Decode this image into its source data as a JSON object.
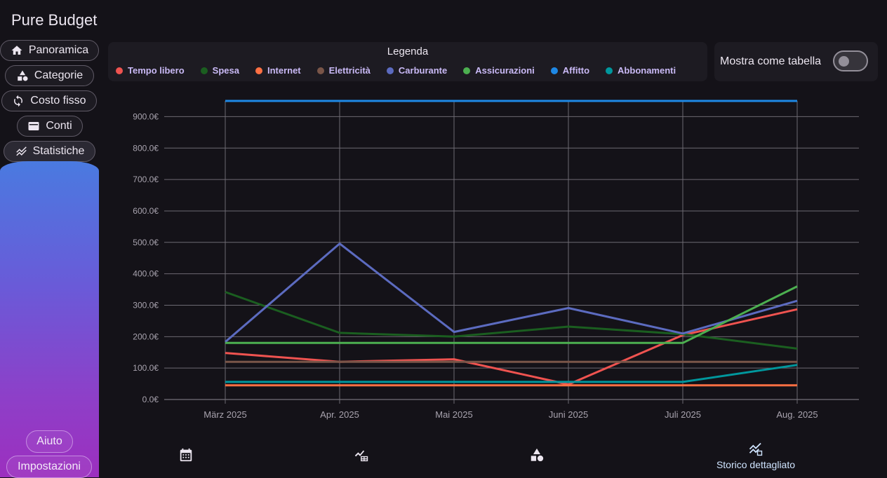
{
  "app": {
    "title": "Pure Budget"
  },
  "nav": {
    "items": [
      {
        "label": "Panoramica",
        "icon": "home-icon"
      },
      {
        "label": "Categorie",
        "icon": "shapes-icon"
      },
      {
        "label": "Costo fisso",
        "icon": "sync-icon"
      },
      {
        "label": "Conti",
        "icon": "wallet-icon"
      },
      {
        "label": "Statistiche",
        "icon": "trending-icon",
        "active": true
      }
    ],
    "bottom": [
      {
        "label": "Aiuto"
      },
      {
        "label": "Impostazioni"
      }
    ]
  },
  "legend": {
    "title": "Legenda"
  },
  "toggle": {
    "label": "Mostra come tabella",
    "on": false
  },
  "bottom_nav": {
    "items": [
      {
        "icon": "calendar-icon",
        "label": ""
      },
      {
        "icon": "chart-table-icon",
        "label": ""
      },
      {
        "icon": "shapes-icon",
        "label": ""
      },
      {
        "icon": "detailed-history-icon",
        "label": "Storico dettagliato",
        "active": true
      }
    ]
  },
  "chart_data": {
    "type": "line",
    "categories": [
      "März 2025",
      "Apr. 2025",
      "Mai 2025",
      "Juni 2025",
      "Juli 2025",
      "Aug. 2025"
    ],
    "ylim": [
      0,
      950
    ],
    "yticks": [
      "0.0€",
      "100.0€",
      "200.0€",
      "300.0€",
      "400.0€",
      "500.0€",
      "600.0€",
      "700.0€",
      "800.0€",
      "900.0€"
    ],
    "grid": true,
    "legend_placement": "top",
    "series": [
      {
        "name": "Tempo libero",
        "color": "#ef5350",
        "values": [
          148,
          120,
          128,
          48,
          205,
          287
        ]
      },
      {
        "name": "Spesa",
        "color": "#1b5e20",
        "values": [
          342,
          212,
          200,
          232,
          208,
          162
        ]
      },
      {
        "name": "Internet",
        "color": "#ff7043",
        "values": [
          45,
          45,
          45,
          45,
          45,
          45
        ]
      },
      {
        "name": "Elettricità",
        "color": "#795548",
        "values": [
          120,
          120,
          120,
          120,
          120,
          120
        ]
      },
      {
        "name": "Carburante",
        "color": "#5c6bc0",
        "values": [
          183,
          496,
          215,
          291,
          210,
          314
        ]
      },
      {
        "name": "Assicurazioni",
        "color": "#4caf50",
        "values": [
          180,
          180,
          180,
          180,
          180,
          360
        ]
      },
      {
        "name": "Affitto",
        "color": "#1e88e5",
        "values": [
          950,
          950,
          950,
          950,
          950,
          950
        ]
      },
      {
        "name": "Abbonamenti",
        "color": "#00979d",
        "values": [
          56,
          56,
          56,
          56,
          56,
          110
        ]
      }
    ]
  }
}
